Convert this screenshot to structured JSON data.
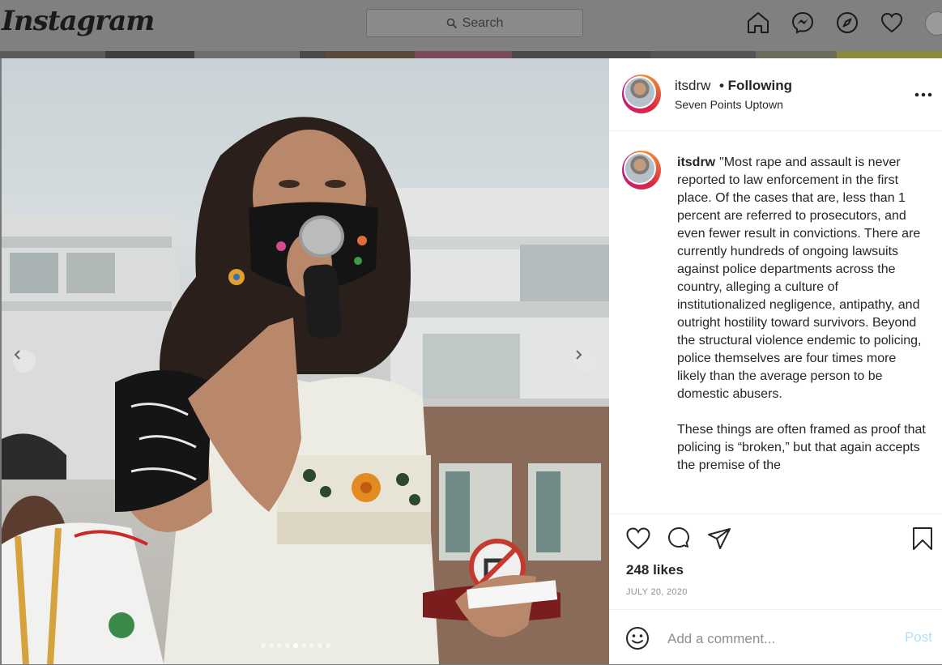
{
  "topnav": {
    "logo": "Instagram",
    "search_placeholder": "Search",
    "icons": [
      "home-icon",
      "messenger-icon",
      "explore-icon",
      "activity-heart-icon",
      "profile-avatar"
    ]
  },
  "carousel": {
    "slide_count": 9,
    "active_index": 4,
    "prev_icon": "chevron-left-icon",
    "next_icon": "chevron-right-icon"
  },
  "post": {
    "username": "itsdrw",
    "follow_status": "• Following",
    "location": "Seven Points Uptown",
    "more_icon": "more-horizontal-icon",
    "caption_username": "itsdrw",
    "caption_paragraphs": [
      "\"Most rape and assault is never reported to law enforcement in the first place. Of the cases that are, less than 1 percent are referred to prosecutors, and even fewer result in convictions. There are currently hundreds of ongoing lawsuits against police departments across the country, alleging a culture of institutionalized negligence, antipathy, and outright hostility toward survivors. Beyond the structural violence endemic to policing, police themselves are four times more likely than the average person to be domestic abusers.",
      "These things are often framed as proof that policing is “broken,” but that again accepts the premise of the"
    ],
    "likes": "248 likes",
    "date": "JULY 20, 2020",
    "comment_placeholder": "Add a comment...",
    "post_label": "Post",
    "post_color": "#b2dffc"
  }
}
